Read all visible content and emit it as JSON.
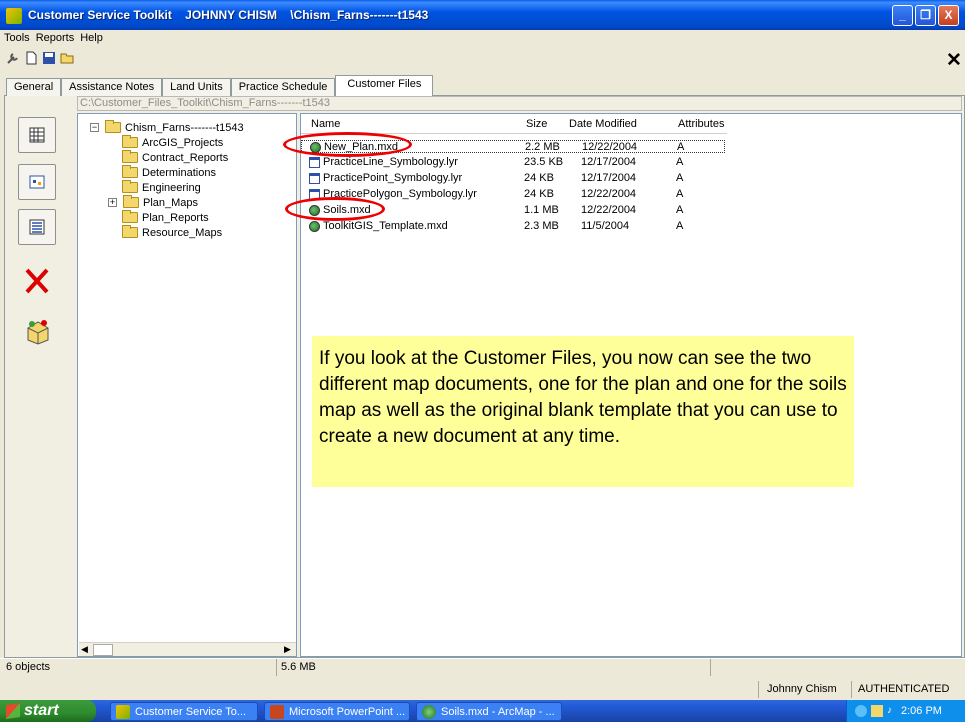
{
  "window": {
    "title": "Customer Service Toolkit    JOHNNY CHISM    \\Chism_Farns-------t1543",
    "controls": [
      "_",
      "❐",
      "X"
    ]
  },
  "menu": [
    "Tools",
    "Reports",
    "Help"
  ],
  "toolbar_icons": [
    "wrench-icon",
    "new-file-icon",
    "save-icon",
    "open-folder-icon"
  ],
  "tabs": [
    {
      "label": "General",
      "active": false
    },
    {
      "label": "Assistance Notes",
      "active": false
    },
    {
      "label": "Land Units",
      "active": false
    },
    {
      "label": "Practice Schedule",
      "active": false
    },
    {
      "label": "Customer Files",
      "active": true
    }
  ],
  "path": "C:\\Customer_Files_Toolkit\\Chism_Farns-------t1543",
  "side_buttons": [
    "grid-view-icon",
    "folder-map-icon",
    "list-view-icon",
    "delete-x-icon",
    "toolbox-icon"
  ],
  "tree": {
    "root": "Chism_Farns-------t1543",
    "items": [
      {
        "label": "ArcGIS_Projects",
        "expandable": false
      },
      {
        "label": "Contract_Reports",
        "expandable": false
      },
      {
        "label": "Determinations",
        "expandable": false
      },
      {
        "label": "Engineering",
        "expandable": false
      },
      {
        "label": "Plan_Maps",
        "expandable": true
      },
      {
        "label": "Plan_Reports",
        "expandable": false
      },
      {
        "label": "Resource_Maps",
        "expandable": false
      }
    ]
  },
  "files": {
    "columns": [
      "Name",
      "Size",
      "Date Modified",
      "Attributes"
    ],
    "rows": [
      {
        "name": "New_Plan.mxd",
        "size": "2.2 MB",
        "date": "12/22/2004",
        "attr": "A",
        "type": "mxd"
      },
      {
        "name": "PracticeLine_Symbology.lyr",
        "size": "23.5 KB",
        "date": "12/17/2004",
        "attr": "A",
        "type": "lyr"
      },
      {
        "name": "PracticePoint_Symbology.lyr",
        "size": "24 KB",
        "date": "12/17/2004",
        "attr": "A",
        "type": "lyr"
      },
      {
        "name": "PracticePolygon_Symbology.lyr",
        "size": "24 KB",
        "date": "12/22/2004",
        "attr": "A",
        "type": "lyr"
      },
      {
        "name": "Soils.mxd",
        "size": "1.1 MB",
        "date": "12/22/2004",
        "attr": "A",
        "type": "mxd"
      },
      {
        "name": "ToolkitGIS_Template.mxd",
        "size": "2.3 MB",
        "date": "11/5/2004",
        "attr": "A",
        "type": "mxd"
      }
    ]
  },
  "callout": "If you look at the Customer Files, you now can see the two different map documents, one for the plan and one for the soils map as well as the original blank template that you can use to create a new document at any time.",
  "status": {
    "objects": "6 objects",
    "total_size": "5.6 MB",
    "user": "Johnny Chism",
    "auth": "AUTHENTICATED"
  },
  "taskbar": {
    "start": "start",
    "tasks": [
      "Customer Service To...",
      "Microsoft PowerPoint ...",
      "Soils.mxd - ArcMap - ..."
    ],
    "clock": "2:06 PM"
  },
  "colors": {
    "highlight_ring": "#EE0000",
    "callout_bg": "#FFFF99",
    "titlebar": "#0054E3"
  }
}
